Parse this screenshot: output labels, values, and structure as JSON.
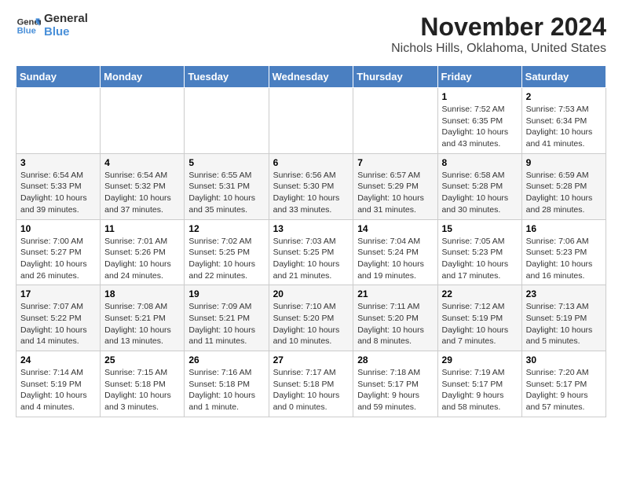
{
  "logo": {
    "line1": "General",
    "line2": "Blue"
  },
  "title": "November 2024",
  "location": "Nichols Hills, Oklahoma, United States",
  "weekdays": [
    "Sunday",
    "Monday",
    "Tuesday",
    "Wednesday",
    "Thursday",
    "Friday",
    "Saturday"
  ],
  "weeks": [
    [
      {
        "day": "",
        "info": ""
      },
      {
        "day": "",
        "info": ""
      },
      {
        "day": "",
        "info": ""
      },
      {
        "day": "",
        "info": ""
      },
      {
        "day": "",
        "info": ""
      },
      {
        "day": "1",
        "info": "Sunrise: 7:52 AM\nSunset: 6:35 PM\nDaylight: 10 hours and 43 minutes."
      },
      {
        "day": "2",
        "info": "Sunrise: 7:53 AM\nSunset: 6:34 PM\nDaylight: 10 hours and 41 minutes."
      }
    ],
    [
      {
        "day": "3",
        "info": "Sunrise: 6:54 AM\nSunset: 5:33 PM\nDaylight: 10 hours and 39 minutes."
      },
      {
        "day": "4",
        "info": "Sunrise: 6:54 AM\nSunset: 5:32 PM\nDaylight: 10 hours and 37 minutes."
      },
      {
        "day": "5",
        "info": "Sunrise: 6:55 AM\nSunset: 5:31 PM\nDaylight: 10 hours and 35 minutes."
      },
      {
        "day": "6",
        "info": "Sunrise: 6:56 AM\nSunset: 5:30 PM\nDaylight: 10 hours and 33 minutes."
      },
      {
        "day": "7",
        "info": "Sunrise: 6:57 AM\nSunset: 5:29 PM\nDaylight: 10 hours and 31 minutes."
      },
      {
        "day": "8",
        "info": "Sunrise: 6:58 AM\nSunset: 5:28 PM\nDaylight: 10 hours and 30 minutes."
      },
      {
        "day": "9",
        "info": "Sunrise: 6:59 AM\nSunset: 5:28 PM\nDaylight: 10 hours and 28 minutes."
      }
    ],
    [
      {
        "day": "10",
        "info": "Sunrise: 7:00 AM\nSunset: 5:27 PM\nDaylight: 10 hours and 26 minutes."
      },
      {
        "day": "11",
        "info": "Sunrise: 7:01 AM\nSunset: 5:26 PM\nDaylight: 10 hours and 24 minutes."
      },
      {
        "day": "12",
        "info": "Sunrise: 7:02 AM\nSunset: 5:25 PM\nDaylight: 10 hours and 22 minutes."
      },
      {
        "day": "13",
        "info": "Sunrise: 7:03 AM\nSunset: 5:25 PM\nDaylight: 10 hours and 21 minutes."
      },
      {
        "day": "14",
        "info": "Sunrise: 7:04 AM\nSunset: 5:24 PM\nDaylight: 10 hours and 19 minutes."
      },
      {
        "day": "15",
        "info": "Sunrise: 7:05 AM\nSunset: 5:23 PM\nDaylight: 10 hours and 17 minutes."
      },
      {
        "day": "16",
        "info": "Sunrise: 7:06 AM\nSunset: 5:23 PM\nDaylight: 10 hours and 16 minutes."
      }
    ],
    [
      {
        "day": "17",
        "info": "Sunrise: 7:07 AM\nSunset: 5:22 PM\nDaylight: 10 hours and 14 minutes."
      },
      {
        "day": "18",
        "info": "Sunrise: 7:08 AM\nSunset: 5:21 PM\nDaylight: 10 hours and 13 minutes."
      },
      {
        "day": "19",
        "info": "Sunrise: 7:09 AM\nSunset: 5:21 PM\nDaylight: 10 hours and 11 minutes."
      },
      {
        "day": "20",
        "info": "Sunrise: 7:10 AM\nSunset: 5:20 PM\nDaylight: 10 hours and 10 minutes."
      },
      {
        "day": "21",
        "info": "Sunrise: 7:11 AM\nSunset: 5:20 PM\nDaylight: 10 hours and 8 minutes."
      },
      {
        "day": "22",
        "info": "Sunrise: 7:12 AM\nSunset: 5:19 PM\nDaylight: 10 hours and 7 minutes."
      },
      {
        "day": "23",
        "info": "Sunrise: 7:13 AM\nSunset: 5:19 PM\nDaylight: 10 hours and 5 minutes."
      }
    ],
    [
      {
        "day": "24",
        "info": "Sunrise: 7:14 AM\nSunset: 5:19 PM\nDaylight: 10 hours and 4 minutes."
      },
      {
        "day": "25",
        "info": "Sunrise: 7:15 AM\nSunset: 5:18 PM\nDaylight: 10 hours and 3 minutes."
      },
      {
        "day": "26",
        "info": "Sunrise: 7:16 AM\nSunset: 5:18 PM\nDaylight: 10 hours and 1 minute."
      },
      {
        "day": "27",
        "info": "Sunrise: 7:17 AM\nSunset: 5:18 PM\nDaylight: 10 hours and 0 minutes."
      },
      {
        "day": "28",
        "info": "Sunrise: 7:18 AM\nSunset: 5:17 PM\nDaylight: 9 hours and 59 minutes."
      },
      {
        "day": "29",
        "info": "Sunrise: 7:19 AM\nSunset: 5:17 PM\nDaylight: 9 hours and 58 minutes."
      },
      {
        "day": "30",
        "info": "Sunrise: 7:20 AM\nSunset: 5:17 PM\nDaylight: 9 hours and 57 minutes."
      }
    ]
  ]
}
